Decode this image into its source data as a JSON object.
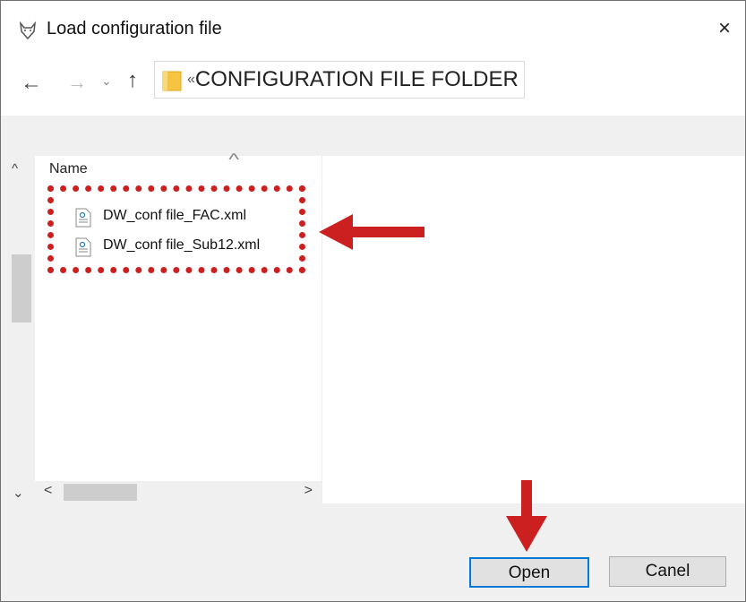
{
  "dialog": {
    "title": "Load configuration file",
    "close_glyph": "×"
  },
  "nav": {
    "back_glyph": "←",
    "forward_glyph": "→",
    "recent_glyph": "⌄",
    "up_glyph": "↑",
    "address_prefix": "«",
    "address_path": "CONFIGURATION FILE FOLDER"
  },
  "filelist": {
    "column_header": "Name",
    "sort_glyph": "^",
    "files": [
      {
        "name": "DW_conf file_FAC.xml",
        "icon": "xml-file-icon"
      },
      {
        "name": "DW_conf file_Sub12.xml",
        "icon": "xml-file-icon"
      }
    ]
  },
  "scrollbars": {
    "up_glyph": "^",
    "down_glyph": "⌄",
    "left_glyph": "<",
    "right_glyph": ">"
  },
  "buttons": {
    "open_label": "Open",
    "cancel_label": "Canel"
  },
  "annotations": {
    "color": "#cc1f1f"
  },
  "colors": {
    "accent": "#0078d7",
    "folder": "#f5c542"
  }
}
